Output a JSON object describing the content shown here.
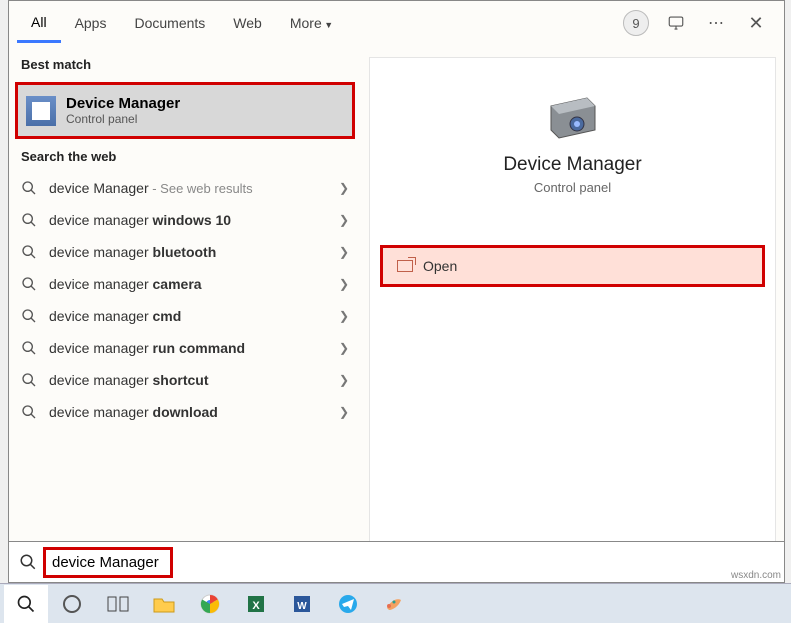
{
  "tabs": {
    "all": "All",
    "apps": "Apps",
    "documents": "Documents",
    "web": "Web",
    "more": "More",
    "badge": "9"
  },
  "sections": {
    "best": "Best match",
    "web": "Search the web"
  },
  "bestMatch": {
    "title": "Device Manager",
    "sub": "Control panel"
  },
  "webResults": [
    {
      "prefix": "device Manager",
      "bold": "",
      "hint": " - See web results"
    },
    {
      "prefix": "device manager ",
      "bold": "windows 10",
      "hint": ""
    },
    {
      "prefix": "device manager ",
      "bold": "bluetooth",
      "hint": ""
    },
    {
      "prefix": "device manager ",
      "bold": "camera",
      "hint": ""
    },
    {
      "prefix": "device manager ",
      "bold": "cmd",
      "hint": ""
    },
    {
      "prefix": "device manager ",
      "bold": "run command",
      "hint": ""
    },
    {
      "prefix": "device manager ",
      "bold": "shortcut",
      "hint": ""
    },
    {
      "prefix": "device manager ",
      "bold": "download",
      "hint": ""
    }
  ],
  "preview": {
    "title": "Device Manager",
    "sub": "Control panel",
    "open": "Open"
  },
  "search": {
    "value": "device Manager"
  },
  "watermark": "wsxdn.com"
}
